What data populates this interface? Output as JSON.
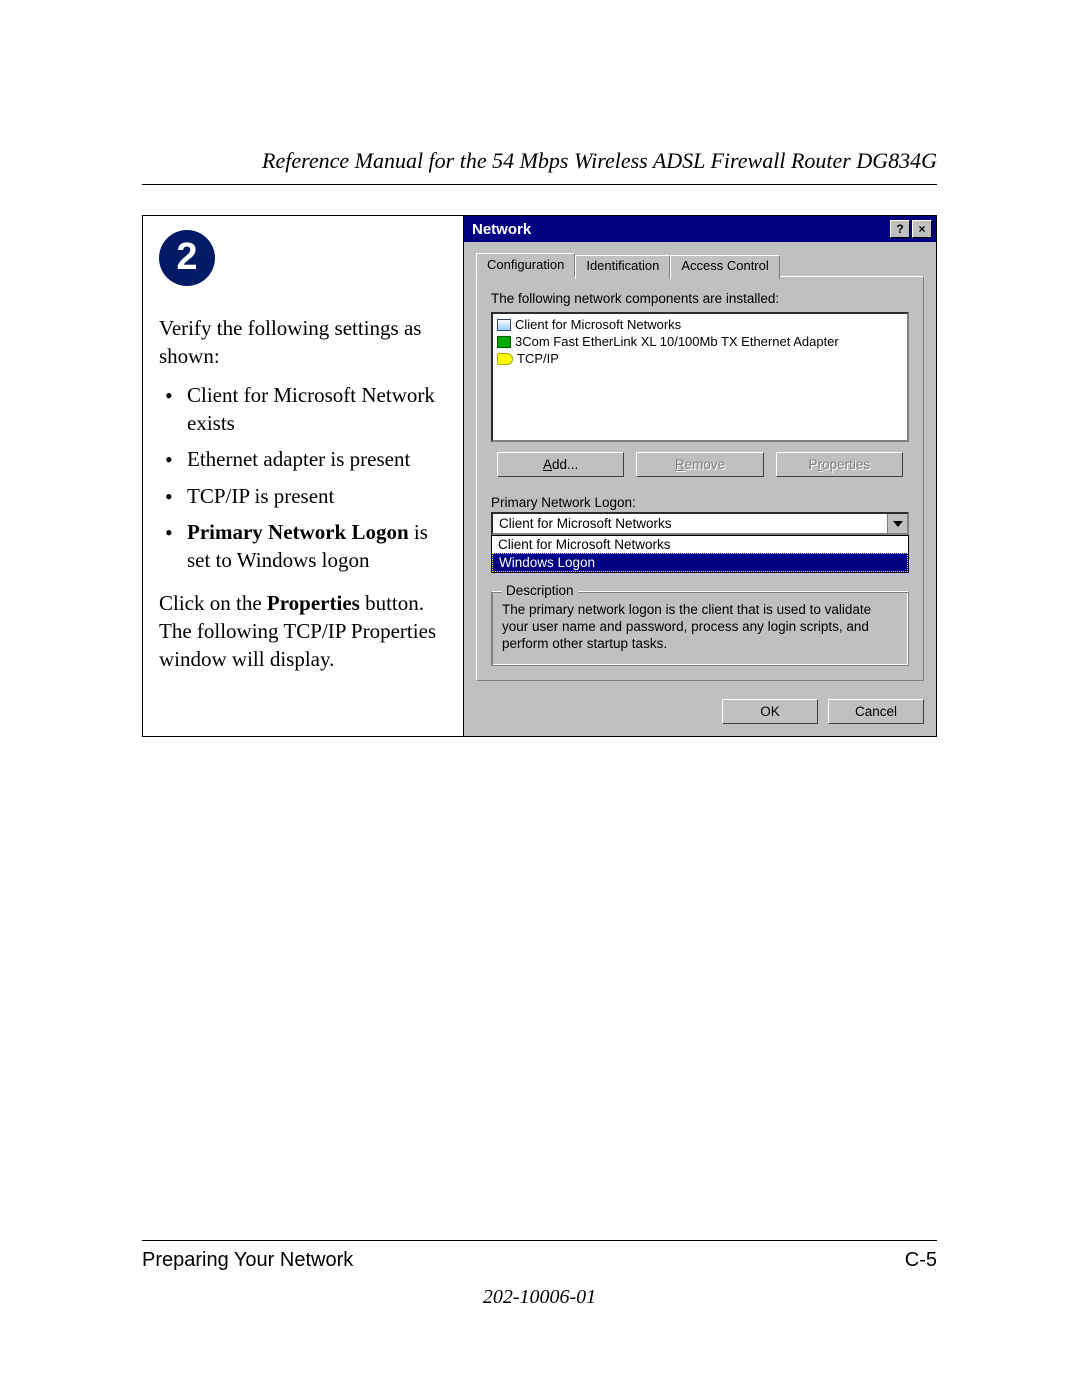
{
  "header": {
    "running_title": "Reference Manual for the 54 Mbps Wireless ADSL Firewall Router DG834G"
  },
  "step": {
    "number": "2",
    "intro": "Verify the following settings as shown:",
    "bullets": [
      {
        "text": "Client for Microsoft Network exists"
      },
      {
        "text": "Ethernet adapter is present"
      },
      {
        "text": "TCP/IP is present"
      },
      {
        "bold_lead": "Primary Network Logon",
        "rest": " is set to Windows logon"
      }
    ],
    "tail_pre": "Click on the ",
    "tail_bold": "Properties",
    "tail_post": " button. The following TCP/IP Properties window will display."
  },
  "dialog": {
    "title": "Network",
    "help_btn": "?",
    "close_btn": "×",
    "tabs": [
      "Configuration",
      "Identification",
      "Access Control"
    ],
    "active_tab": 0,
    "list_caption": "The following network components are installed:",
    "components": [
      {
        "icon": "client",
        "label": "Client for Microsoft Networks"
      },
      {
        "icon": "nic",
        "label": "3Com Fast EtherLink XL 10/100Mb TX Ethernet Adapter"
      },
      {
        "icon": "proto",
        "label": "TCP/IP"
      }
    ],
    "buttons": {
      "add": {
        "u": "A",
        "rest": "dd..."
      },
      "remove": {
        "u": "R",
        "rest": "emove"
      },
      "properties": {
        "pre": "P",
        "u": "r",
        "rest": "operties"
      }
    },
    "primary_logon_label": "Primary Network Logon:",
    "primary_logon_value": "Client for Microsoft Networks",
    "dropdown_options": [
      {
        "label": "Client for Microsoft Networks",
        "selected": false
      },
      {
        "label": "Windows Logon",
        "selected": true
      }
    ],
    "description_legend": "Description",
    "description_text": "The primary network logon is the client that is used to validate your user name and password, process any login scripts, and perform other startup tasks.",
    "ok": "OK",
    "cancel": "Cancel"
  },
  "footer": {
    "section": "Preparing Your Network",
    "page": "C-5",
    "docnum": "202-10006-01"
  }
}
